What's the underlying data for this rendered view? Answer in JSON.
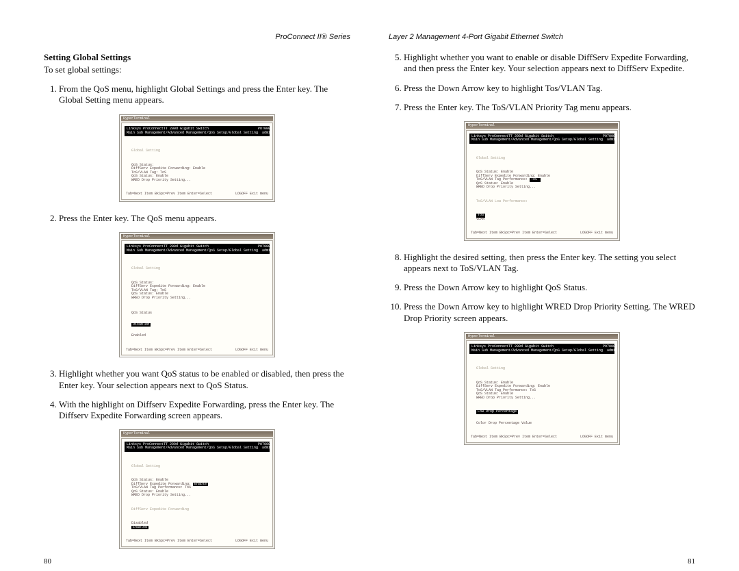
{
  "left": {
    "running": "ProConnect II® Series",
    "heading": "Setting Global Settings",
    "intro": "To set global settings:",
    "steps1": [
      "From the QoS menu, highlight Global Settings and press the Enter key. The Global Setting menu appears."
    ],
    "steps2": [
      "Press the Enter key. The QoS menu appears."
    ],
    "steps3": [
      "Highlight whether you want QoS status to be enabled or disabled, then press the Enter key. Your selection appears next to QoS Status.",
      "With the highlight on Diffserv Expedite Forwarding, press the Enter key. The Diffserv Expedite Forwarding screen appears."
    ],
    "pagenum": "80"
  },
  "right": {
    "running": "Layer 2 Management 4-Port Gigabit Ethernet Switch",
    "steps5": [
      "Highlight whether you want to enable or disable DiffServ Expedite Forwarding, and then press the Enter key. Your selection appears next to DiffServ Expedite.",
      "Press the Down Arrow key to highlight Tos/VLAN Tag.",
      "Press the Enter key. The ToS/VLAN Priority Tag menu appears."
    ],
    "steps8": [
      "Highlight the desired setting, then press the Enter key. The setting you select appears next to ToS/VLAN Tag.",
      "Press the Down Arrow key to highlight QoS Status.",
      "Press the Down Arrow key to highlight WRED Drop Priority Setting. The WRED Drop Priority screen appears."
    ],
    "pagenum": "81"
  },
  "shot": {
    "winTitle": "HyperTerminal",
    "headerL": "Linksys ProConnectTT 200d Gigabit Switch",
    "headerR1": "PO7000L",
    "headerR2": "admin",
    "headerSub": "Main Sub Management/Advanced Management/QoS Setup/Global Setting",
    "section": "Global Setting",
    "lines": "QoS Status:\nDiffServ Expedite Forwarding: Enable\nToS/VLAN Tag: ToS\nQoS Status: Enable\nWRED Drop Priority Setting...",
    "lowPerf": "ToS/VLAN Low Performance:",
    "expFwd": "DiffServ Expedite Forwarding",
    "dropPrio": "Low Drop Percentage",
    "subDrop": "Color Drop Percentage Value",
    "optDisabled": "Disabled",
    "optEnabled": "Enabled",
    "tagVal": "ToS",
    "footL": "Tab=Next Item  BkSpc=Prev Item  Enter=Select",
    "footR": "LOGOFF Exit menu"
  }
}
